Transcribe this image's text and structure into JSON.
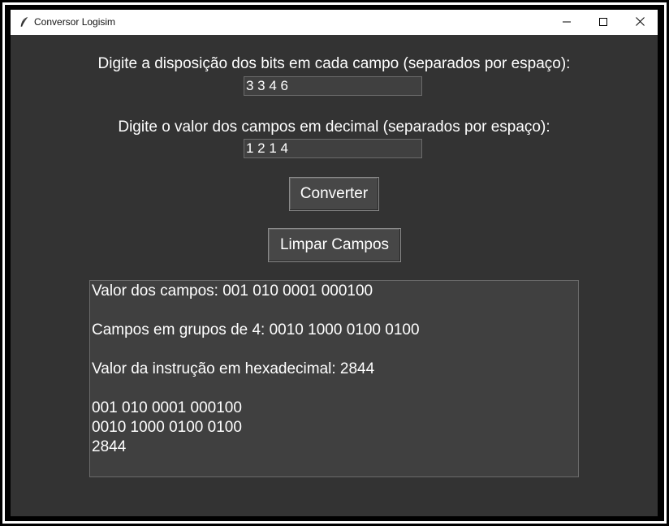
{
  "window": {
    "title": "Conversor Logisim",
    "controls": {
      "minimize_icon": "minimize-icon",
      "maximize_icon": "maximize-icon",
      "close_icon": "close-icon"
    }
  },
  "form": {
    "bits_label": "Digite a disposição dos bits em cada campo (separados por espaço):",
    "bits_value": "3 3 4 6",
    "values_label": "Digite o valor dos campos em decimal (separados por espaço):",
    "values_value": "1 2 1 4",
    "convert_label": "Converter",
    "clear_label": "Limpar Campos"
  },
  "output": {
    "lines": [
      "Valor dos campos: 001 010 0001 000100",
      "",
      "Campos em grupos de 4: 0010 1000 0100 0100",
      "",
      "Valor da instrução em hexadecimal: 2844",
      "",
      "001 010 0001 000100",
      "0010 1000 0100 0100",
      "2844"
    ]
  },
  "colors": {
    "background": "#333333",
    "field": "#404040",
    "button": "#474747",
    "text": "#ffffff"
  }
}
